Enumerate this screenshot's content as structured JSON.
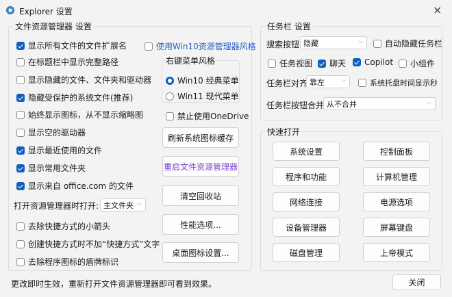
{
  "window": {
    "title": "Explorer 设置",
    "close_icon": "×"
  },
  "explorer": {
    "title": "文件资源管理器 设置",
    "checks": [
      {
        "label": "显示所有文件的文件扩展名",
        "checked": true
      },
      {
        "label": "在标题栏中显示完整路径",
        "checked": false
      },
      {
        "label": "显示隐藏的文件、文件夹和驱动器",
        "checked": false
      },
      {
        "label": "隐藏受保护的系统文件(推荐)",
        "checked": true
      },
      {
        "label": "始终显示图标，从不显示缩略图",
        "checked": false
      },
      {
        "label": "显示空的驱动器",
        "checked": false
      },
      {
        "label": "显示最近使用的文件",
        "checked": true
      },
      {
        "label": "显示常用文件夹",
        "checked": true
      },
      {
        "label": "显示来自 office.com 的文件",
        "checked": true
      }
    ],
    "open_label": "打开资源管理器时打开:",
    "open_value": "主文件夹",
    "checks2": [
      {
        "label": "去除快捷方式的小箭头",
        "checked": false
      },
      {
        "label": "创建快捷方式时不加“快捷方式”文字",
        "checked": false
      },
      {
        "label": "去除程序图标的盾牌标识",
        "checked": false
      }
    ],
    "win10_style": {
      "label": "使用Win10资源管理器风格",
      "checked": false,
      "color": "#2a5fc4"
    },
    "context_menu": {
      "title": "右键菜单风格",
      "options": [
        {
          "label": "Win10 经典菜单",
          "selected": true
        },
        {
          "label": "Win11 现代菜单",
          "selected": false
        }
      ]
    },
    "onedrive": {
      "label": "禁止使用OneDrive",
      "checked": false
    },
    "buttons": [
      "刷新系统图标缓存",
      "重启文件资源管理器",
      "清空回收站",
      "性能选项...",
      "桌面图标设置..."
    ],
    "restart_color": "#7b3fd0"
  },
  "taskbar": {
    "title": "任务栏 设置",
    "search_label": "搜索按钮",
    "search_value": "隐藏",
    "autohide": {
      "label": "自动隐藏任务栏",
      "checked": false
    },
    "taskview": {
      "label": "任务视图",
      "checked": false
    },
    "chat": {
      "label": "聊天",
      "checked": true
    },
    "copilot": {
      "label": "Copilot",
      "checked": true
    },
    "widgets": {
      "label": "小组件",
      "checked": false
    },
    "align_label": "任务栏对齐",
    "align_value": "靠左",
    "seconds": {
      "label": "系统托盘时间显示秒",
      "checked": false
    },
    "combine_label": "任务栏按钮合并",
    "combine_value": "从不合并"
  },
  "quick": {
    "title": "快速打开",
    "buttons": [
      "系统设置",
      "控制面板",
      "程序和功能",
      "计算机管理",
      "网络连接",
      "电源选项",
      "设备管理器",
      "屏幕键盘",
      "磁盘管理",
      "上帝模式"
    ]
  },
  "footer": {
    "note": "更改即时生效，重新打开文件资源管理器即可看到效果。",
    "close": "关闭"
  }
}
